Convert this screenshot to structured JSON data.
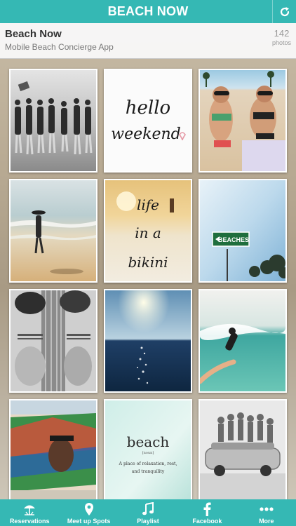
{
  "header": {
    "title": "BEACH NOW",
    "refresh_icon": "refresh-icon",
    "accent_color": "#35b8b4"
  },
  "album": {
    "name": "Beach Now",
    "description": "Mobile Beach Concierge App",
    "photo_count": "142",
    "photo_unit": "photos"
  },
  "photos": [
    {
      "alt": "vintage-bathing-beauties"
    },
    {
      "alt": "hello-weekend",
      "text_line1": "hello",
      "text_line2": "weekend"
    },
    {
      "alt": "two-women-bikinis"
    },
    {
      "alt": "surfer-on-shore"
    },
    {
      "alt": "life-in-a-bikini",
      "text_line1": "life",
      "text_line2": "in a",
      "text_line3": "bikini"
    },
    {
      "alt": "beaches-sign",
      "sign_text": "BEACHES"
    },
    {
      "alt": "feet-on-skateboard"
    },
    {
      "alt": "sun-over-ocean"
    },
    {
      "alt": "surfer-in-wave"
    },
    {
      "alt": "venice-mural"
    },
    {
      "alt": "beach-definition",
      "word": "beach",
      "pos": "[noun]",
      "def_line1": "A place of relaxation, rest,",
      "def_line2": "and tranquility"
    },
    {
      "alt": "surfers-on-car"
    }
  ],
  "tabs": [
    {
      "label": "Reservations",
      "icon": "beach-umbrella-icon"
    },
    {
      "label": "Meet up Spots",
      "icon": "map-pin-icon"
    },
    {
      "label": "Playlist",
      "icon": "music-note-icon"
    },
    {
      "label": "Facebook",
      "icon": "facebook-icon"
    },
    {
      "label": "More",
      "icon": "more-dots-icon"
    }
  ]
}
